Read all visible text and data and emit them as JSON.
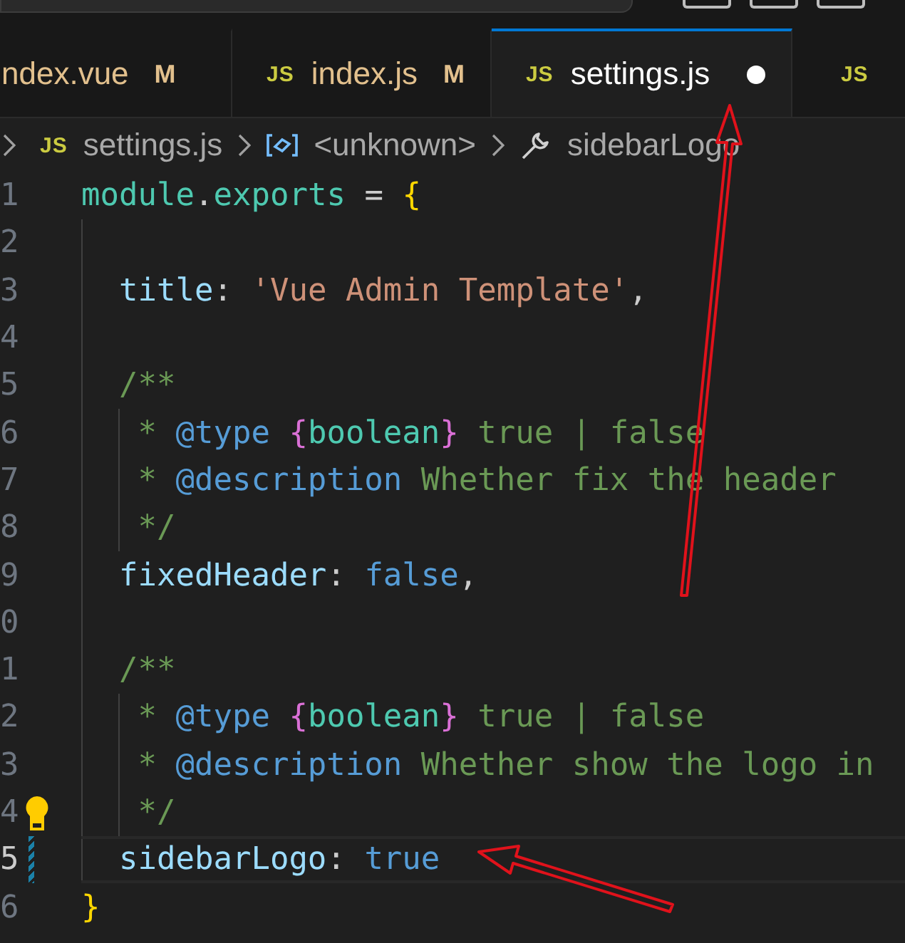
{
  "tabs": [
    {
      "label": "ndex.vue",
      "badge": "M",
      "selected": false,
      "modified": true,
      "dirty": false
    },
    {
      "label": "index.js",
      "badge": "M",
      "icon": "JS",
      "selected": false,
      "modified": true,
      "dirty": false
    },
    {
      "label": "settings.js",
      "icon": "JS",
      "selected": true,
      "modified": false,
      "dirty": true
    },
    {
      "icon": "JS",
      "selected": false
    }
  ],
  "breadcrumb": [
    {
      "kind": "file",
      "icon": "JS",
      "label": "settings.js"
    },
    {
      "kind": "symbol",
      "label": "<unknown>"
    },
    {
      "kind": "property",
      "label": "sidebarLogo"
    }
  ],
  "lines": [
    {
      "number": "1",
      "tokens": [
        {
          "t": "module",
          "kind": "type"
        },
        {
          "t": ".",
          "kind": "plain"
        },
        {
          "t": "exports",
          "kind": "type"
        },
        {
          "t": " = ",
          "kind": "plain"
        },
        {
          "t": "{",
          "kind": "brace"
        }
      ]
    },
    {
      "number": "2",
      "guides": [
        {
          "kind": "block"
        }
      ]
    },
    {
      "number": "3",
      "guides": [
        {
          "kind": "block"
        }
      ],
      "tokens": [
        {
          "t": "title",
          "kind": "prop"
        },
        {
          "t": ": ",
          "kind": "plain"
        },
        {
          "t": "'Vue Admin Template'",
          "kind": "string"
        },
        {
          "t": ",",
          "kind": "plain"
        }
      ]
    },
    {
      "number": "4",
      "guides": [
        {
          "kind": "block"
        }
      ]
    },
    {
      "number": "5",
      "guides": [
        {
          "kind": "block"
        }
      ],
      "tokens": [
        {
          "t": "/**",
          "kind": "comment"
        }
      ]
    },
    {
      "number": "6",
      "guides": [
        {
          "kind": "block"
        },
        {
          "kind": "comment"
        }
      ],
      "tokens": [
        {
          "t": "* ",
          "kind": "comment"
        },
        {
          "t": "@type ",
          "kind": "tag"
        },
        {
          "t": "{",
          "kind": "cbrace"
        },
        {
          "t": "boolean",
          "kind": "type"
        },
        {
          "t": "}",
          "kind": "cbrace"
        },
        {
          "t": " true | false",
          "kind": "comment"
        }
      ]
    },
    {
      "number": "7",
      "guides": [
        {
          "kind": "block"
        },
        {
          "kind": "comment"
        }
      ],
      "tokens": [
        {
          "t": "* ",
          "kind": "comment"
        },
        {
          "t": "@description",
          "kind": "tag"
        },
        {
          "t": " Whether fix the header",
          "kind": "comment"
        }
      ]
    },
    {
      "number": "8",
      "guides": [
        {
          "kind": "block"
        },
        {
          "kind": "comment"
        }
      ],
      "tokens": [
        {
          "t": "*/",
          "kind": "comment"
        }
      ]
    },
    {
      "number": "9",
      "guides": [
        {
          "kind": "block"
        }
      ],
      "tokens": [
        {
          "t": "fixedHeader",
          "kind": "prop"
        },
        {
          "t": ": ",
          "kind": "plain"
        },
        {
          "t": "false",
          "kind": "bool"
        },
        {
          "t": ",",
          "kind": "plain"
        }
      ]
    },
    {
      "number": "0",
      "guides": [
        {
          "kind": "block"
        }
      ]
    },
    {
      "number": "1",
      "guides": [
        {
          "kind": "block"
        }
      ],
      "tokens": [
        {
          "t": "/**",
          "kind": "comment"
        }
      ]
    },
    {
      "number": "2",
      "guides": [
        {
          "kind": "block"
        },
        {
          "kind": "comment"
        }
      ],
      "tokens": [
        {
          "t": "* ",
          "kind": "comment"
        },
        {
          "t": "@type ",
          "kind": "tag"
        },
        {
          "t": "{",
          "kind": "cbrace"
        },
        {
          "t": "boolean",
          "kind": "type"
        },
        {
          "t": "}",
          "kind": "cbrace"
        },
        {
          "t": " true | false",
          "kind": "comment"
        }
      ]
    },
    {
      "number": "3",
      "guides": [
        {
          "kind": "block"
        },
        {
          "kind": "comment"
        }
      ],
      "tokens": [
        {
          "t": "* ",
          "kind": "comment"
        },
        {
          "t": "@description",
          "kind": "tag"
        },
        {
          "t": " Whether show the logo in",
          "kind": "comment"
        }
      ]
    },
    {
      "number": "4",
      "lightbulb": true,
      "guides": [
        {
          "kind": "block"
        },
        {
          "kind": "comment"
        }
      ],
      "tokens": [
        {
          "t": "*/",
          "kind": "comment"
        }
      ]
    },
    {
      "number": "5",
      "current": true,
      "modified": true,
      "guides": [
        {
          "kind": "block"
        }
      ],
      "tokens": [
        {
          "t": "sidebarLogo",
          "kind": "prop"
        },
        {
          "t": ": ",
          "kind": "plain"
        },
        {
          "t": "true",
          "kind": "bool"
        }
      ]
    },
    {
      "number": "6",
      "tokens": [
        {
          "t": "}",
          "kind": "brace"
        }
      ]
    }
  ]
}
